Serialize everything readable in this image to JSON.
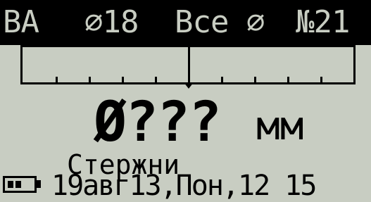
{
  "header": {
    "mode": "ВА",
    "diameter": "⌀18",
    "filter": "Все ⌀",
    "record_number": "№21"
  },
  "scale": {
    "ticks": 9,
    "needle_level": 0.5
  },
  "measurement": {
    "value": "Ø???",
    "units": "мм",
    "object": "Стержни"
  },
  "status": {
    "battery_icon": "battery-icon",
    "battery_level": 0.5,
    "datetime": "19авг13,Пон,12 15"
  }
}
